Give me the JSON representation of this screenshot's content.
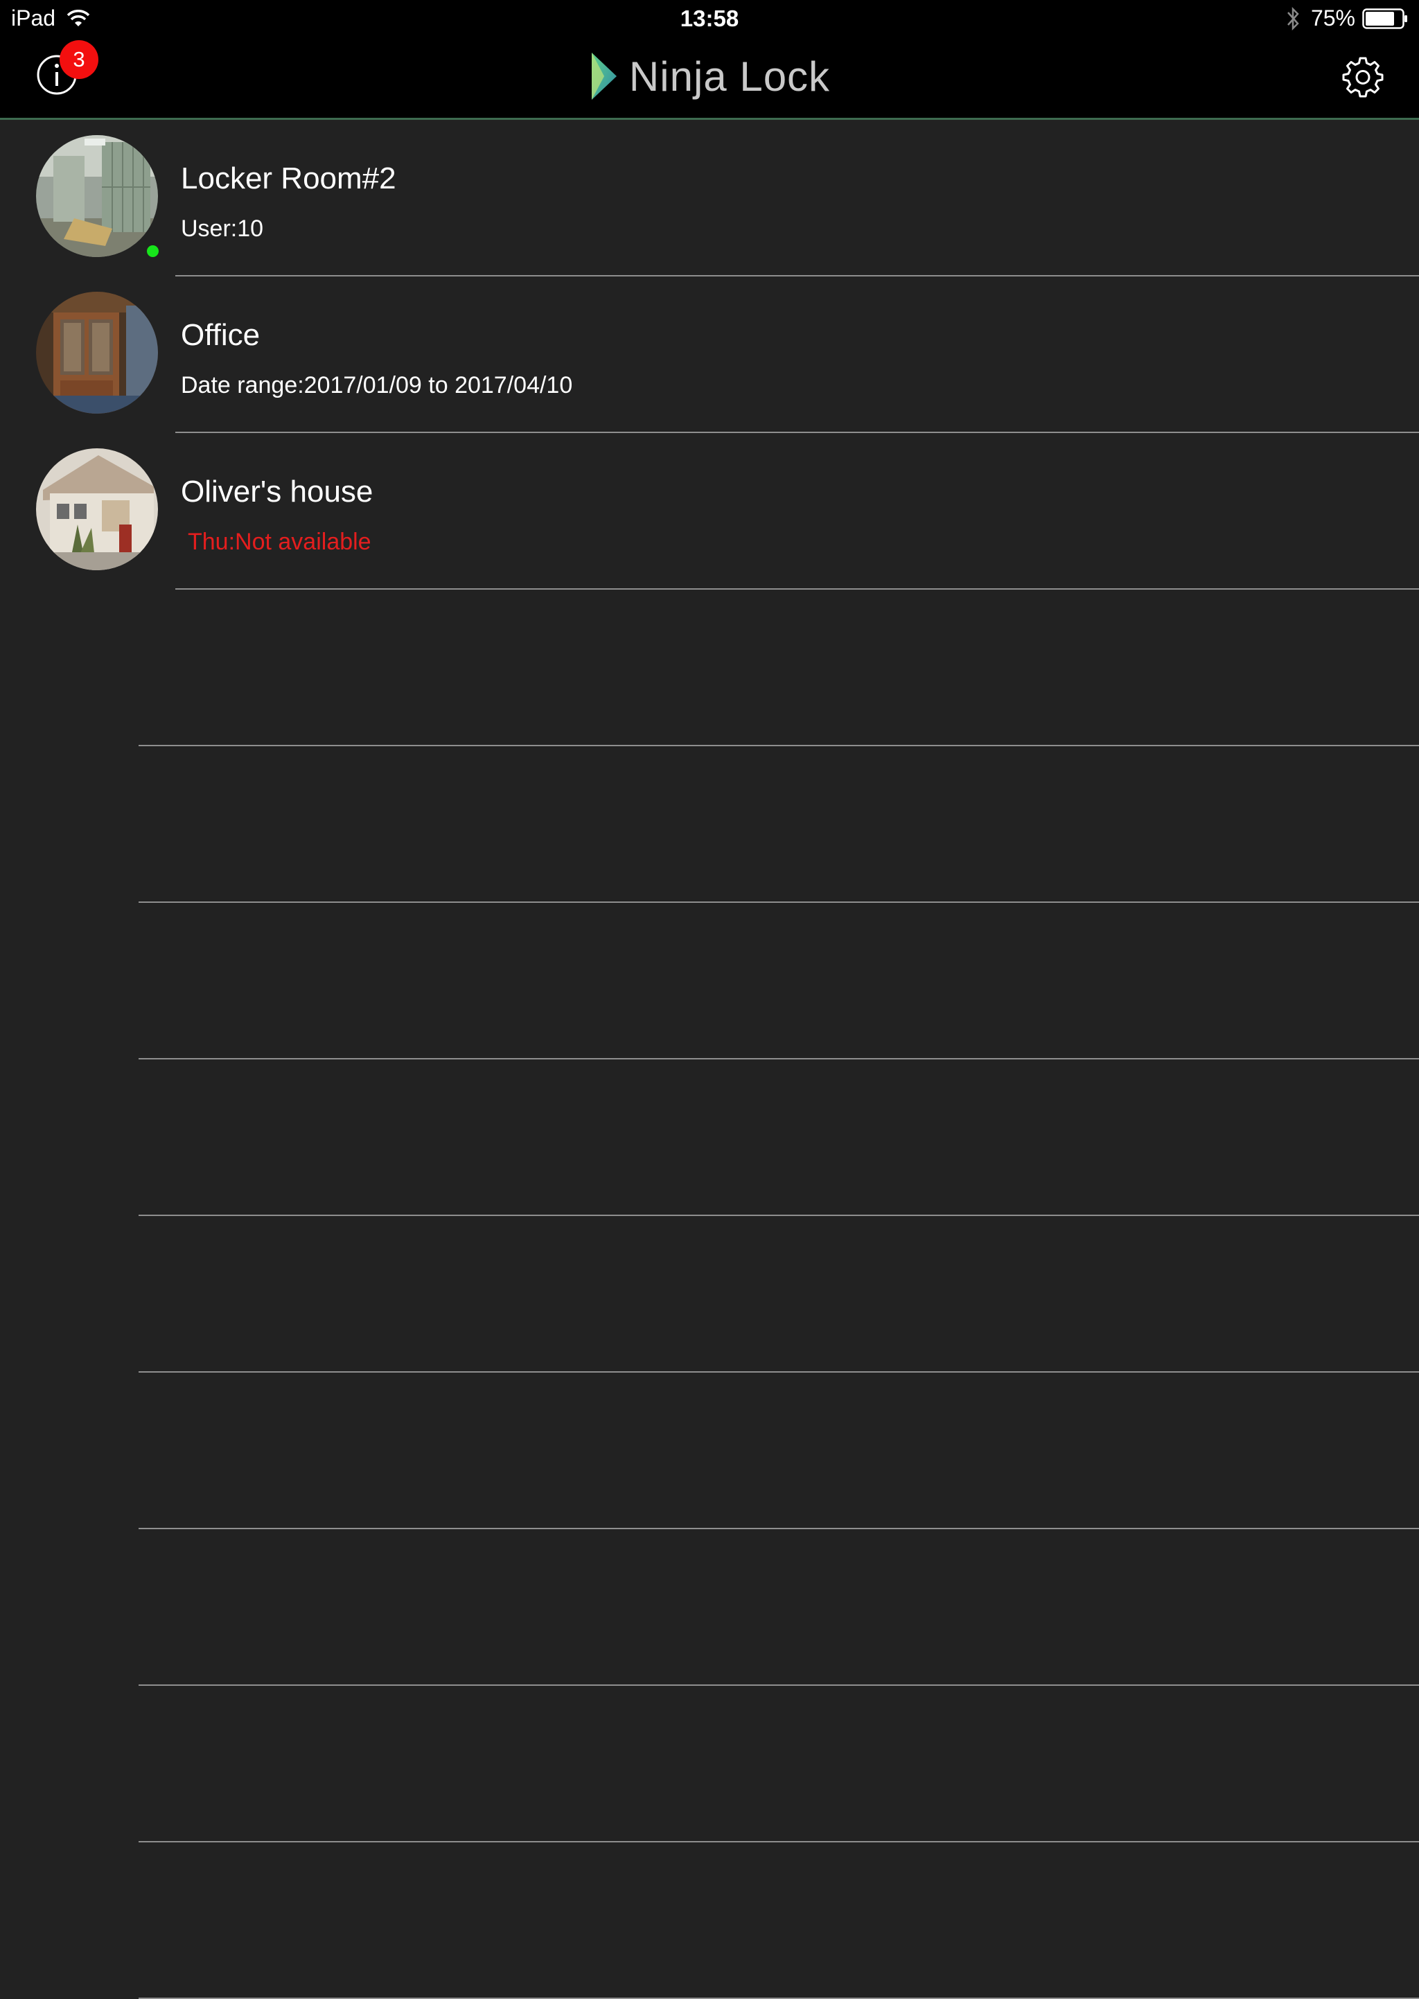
{
  "status_bar": {
    "device": "iPad",
    "time": "13:58",
    "battery": "75%"
  },
  "nav": {
    "brand": "Ninja Lock",
    "notification_count": "3"
  },
  "locks": [
    {
      "name": "Locker Room#2",
      "detail": "User:10",
      "detail_status": "normal",
      "online": true
    },
    {
      "name": "Office",
      "detail": "Date range:2017/01/09 to 2017/04/10",
      "detail_status": "normal",
      "online": false
    },
    {
      "name": "Oliver's house",
      "detail": "Thu:Not available",
      "detail_status": "warning",
      "online": false
    }
  ],
  "colors": {
    "background": "#222222",
    "bar": "#000000",
    "badge": "#f30f0f",
    "online": "#17e51b",
    "warning": "#e41e1e"
  }
}
